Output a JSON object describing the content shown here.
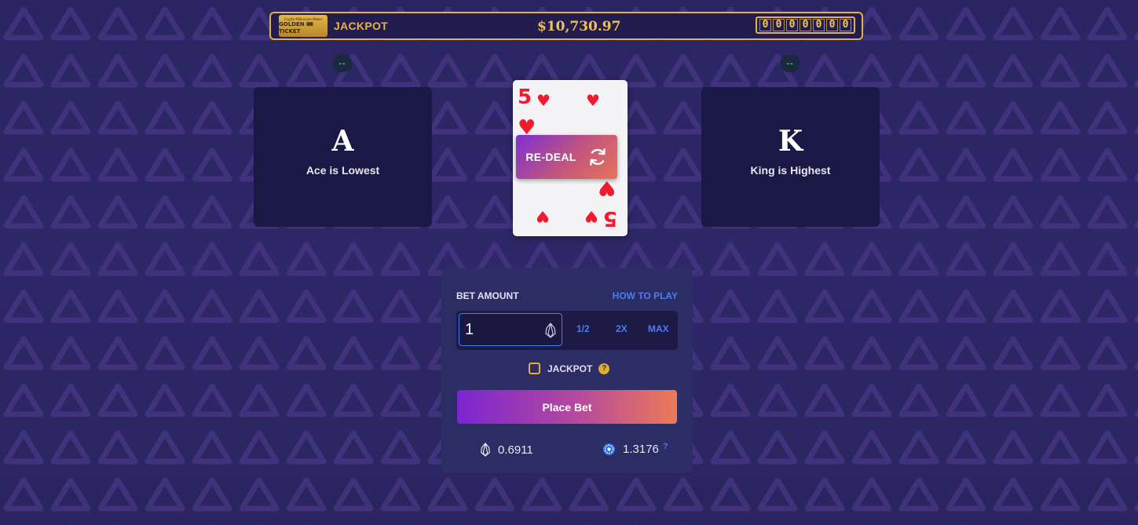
{
  "jackpot": {
    "ticket_line1": "Crypto Millionaire Maker",
    "ticket_line2": "GOLDEN 🎟 TICKET",
    "label": "JACKPOT",
    "amount": "$10,730.97",
    "digits": [
      "0",
      "0",
      "0",
      "0",
      "0",
      "0",
      "0"
    ]
  },
  "left_card": {
    "indicator": "--",
    "rank": "A",
    "caption": "Ace is Lowest"
  },
  "right_card": {
    "indicator": "--",
    "rank": "K",
    "caption": "King is Highest"
  },
  "current_card": {
    "rank": "5",
    "suit": "♥",
    "color": "#f21b2d"
  },
  "redeal": {
    "label": "RE-DEAL",
    "icon": "refresh-icon"
  },
  "bet_panel": {
    "bet_amount_label": "BET AMOUNT",
    "how_to_play": "HOW TO PLAY",
    "input_value": "1",
    "currency_icon": "eos-icon",
    "modifiers": {
      "half": "1/2",
      "double": "2X",
      "max": "MAX"
    },
    "jackpot_label": "JACKPOT",
    "jackpot_checked": false,
    "jackpot_help": "?",
    "place_bet": "Place Bet",
    "eos_balance": "0.6911",
    "token_balance": "1.3176",
    "token_help": "?"
  },
  "colors": {
    "background": "#2b2563",
    "gold": "#e3b23c",
    "accent_blue": "#4c7bf0",
    "panel": "#2d2d66",
    "card_panel": "#1a1945"
  }
}
